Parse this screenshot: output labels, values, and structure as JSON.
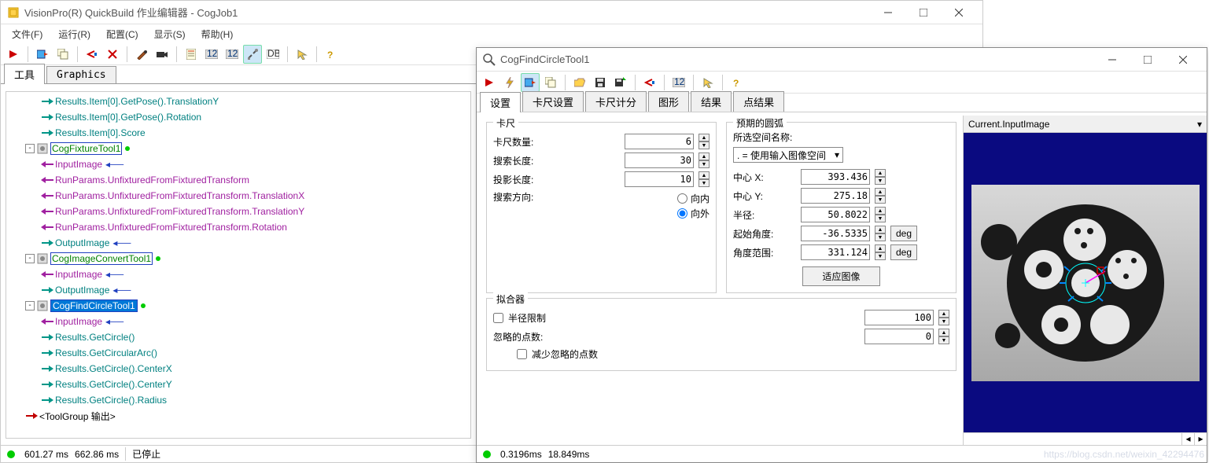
{
  "main": {
    "title": "VisionPro(R) QuickBuild 作业编辑器 - CogJob1",
    "menu": {
      "file": "文件(F)",
      "run": "运行(R)",
      "config": "配置(C)",
      "show": "显示(S)",
      "help": "帮助(H)"
    },
    "tabs": {
      "tools": "工具",
      "graphics": "Graphics"
    },
    "status": {
      "t1": "601.27 ms",
      "t2": "662.86 ms",
      "state": "已停止"
    }
  },
  "tree": {
    "items": [
      {
        "ind": 40,
        "label": "Results.Item[0].GetPose().TranslationY",
        "cls": "",
        "arrow": "r",
        "ac": "#009688"
      },
      {
        "ind": 40,
        "label": "Results.Item[0].GetPose().Rotation",
        "cls": "",
        "arrow": "r",
        "ac": "#009688"
      },
      {
        "ind": 40,
        "label": "Results.Item[0].Score",
        "cls": "",
        "arrow": "r",
        "ac": "#009688"
      },
      {
        "ind": 20,
        "label": "CogFixtureTool1",
        "cls": "green",
        "toggle": "-",
        "dot": true,
        "box": true
      },
      {
        "ind": 40,
        "label": "InputImage",
        "cls": "purple",
        "arrow": "l",
        "ac": "#a020a0",
        "link": true
      },
      {
        "ind": 40,
        "label": "RunParams.UnfixturedFromFixturedTransform",
        "cls": "purple",
        "arrow": "l",
        "ac": "#a020a0"
      },
      {
        "ind": 40,
        "label": "RunParams.UnfixturedFromFixturedTransform.TranslationX",
        "cls": "purple",
        "arrow": "l",
        "ac": "#a020a0"
      },
      {
        "ind": 40,
        "label": "RunParams.UnfixturedFromFixturedTransform.TranslationY",
        "cls": "purple",
        "arrow": "l",
        "ac": "#a020a0"
      },
      {
        "ind": 40,
        "label": "RunParams.UnfixturedFromFixturedTransform.Rotation",
        "cls": "purple",
        "arrow": "l",
        "ac": "#a020a0"
      },
      {
        "ind": 40,
        "label": "OutputImage",
        "cls": "",
        "arrow": "r",
        "ac": "#009688",
        "link": true
      },
      {
        "ind": 20,
        "label": "CogImageConvertTool1",
        "cls": "green",
        "toggle": "-",
        "dot": true,
        "box": true
      },
      {
        "ind": 40,
        "label": "InputImage",
        "cls": "purple",
        "arrow": "l",
        "ac": "#a020a0",
        "link": true
      },
      {
        "ind": 40,
        "label": "OutputImage",
        "cls": "",
        "arrow": "r",
        "ac": "#009688",
        "link": true
      },
      {
        "ind": 20,
        "label": "CogFindCircleTool1",
        "cls": "selected",
        "toggle": "-",
        "dot": true,
        "box": true,
        "sel": true
      },
      {
        "ind": 40,
        "label": "InputImage",
        "cls": "purple",
        "arrow": "l",
        "ac": "#a020a0",
        "link": true
      },
      {
        "ind": 40,
        "label": "Results.GetCircle()",
        "cls": "",
        "arrow": "r",
        "ac": "#009688"
      },
      {
        "ind": 40,
        "label": "Results.GetCircularArc()",
        "cls": "",
        "arrow": "r",
        "ac": "#009688"
      },
      {
        "ind": 40,
        "label": "Results.GetCircle().CenterX",
        "cls": "",
        "arrow": "r",
        "ac": "#009688"
      },
      {
        "ind": 40,
        "label": "Results.GetCircle().CenterY",
        "cls": "",
        "arrow": "r",
        "ac": "#009688"
      },
      {
        "ind": 40,
        "label": "Results.GetCircle().Radius",
        "cls": "",
        "arrow": "r",
        "ac": "#009688"
      },
      {
        "ind": 20,
        "label": "<ToolGroup 输出>",
        "cls": "black",
        "arrow": "r",
        "ac": "#c00000"
      }
    ]
  },
  "child": {
    "title": "CogFindCircleTool1",
    "tabs": {
      "settings": "设置",
      "caliper_settings": "卡尺设置",
      "caliper_score": "卡尺计分",
      "graphic": "图形",
      "results": "结果",
      "point_results": "点结果"
    },
    "status": {
      "t1": "0.3196ms",
      "t2": "18.849ms"
    },
    "form": {
      "caliper_group": "卡尺",
      "num_calipers_label": "卡尺数量:",
      "num_calipers": "6",
      "search_len_label": "搜索长度:",
      "search_len": "30",
      "proj_len_label": "投影长度:",
      "proj_len": "10",
      "search_dir_label": "搜索方向:",
      "radio_in": "向内",
      "radio_out": "向外",
      "expected_arc_group": "预期的圆弧",
      "space_label": "所选空间名称:",
      "space_value": ". = 使用输入图像空间",
      "cx_label": "中心 X:",
      "cx": "393.436",
      "cy_label": "中心 Y:",
      "cy": "275.18",
      "radius_label": "半径:",
      "radius": "50.8022",
      "start_ang_label": "起始角度:",
      "start_ang": "-36.5335",
      "ang_span_label": "角度范围:",
      "ang_span": "331.124",
      "deg": "deg",
      "fit_btn": "适应图像",
      "fitter_group": "拟合器",
      "radius_constraint": "半径限制",
      "radius_constraint_val": "100",
      "ignore_pts_label": "忽略的点数:",
      "ignore_pts_val": "0",
      "reduce_ignore": "减少忽略的点数"
    },
    "image_header": "Current.InputImage"
  },
  "watermark": "https://blog.csdn.net/weixin_42294476"
}
